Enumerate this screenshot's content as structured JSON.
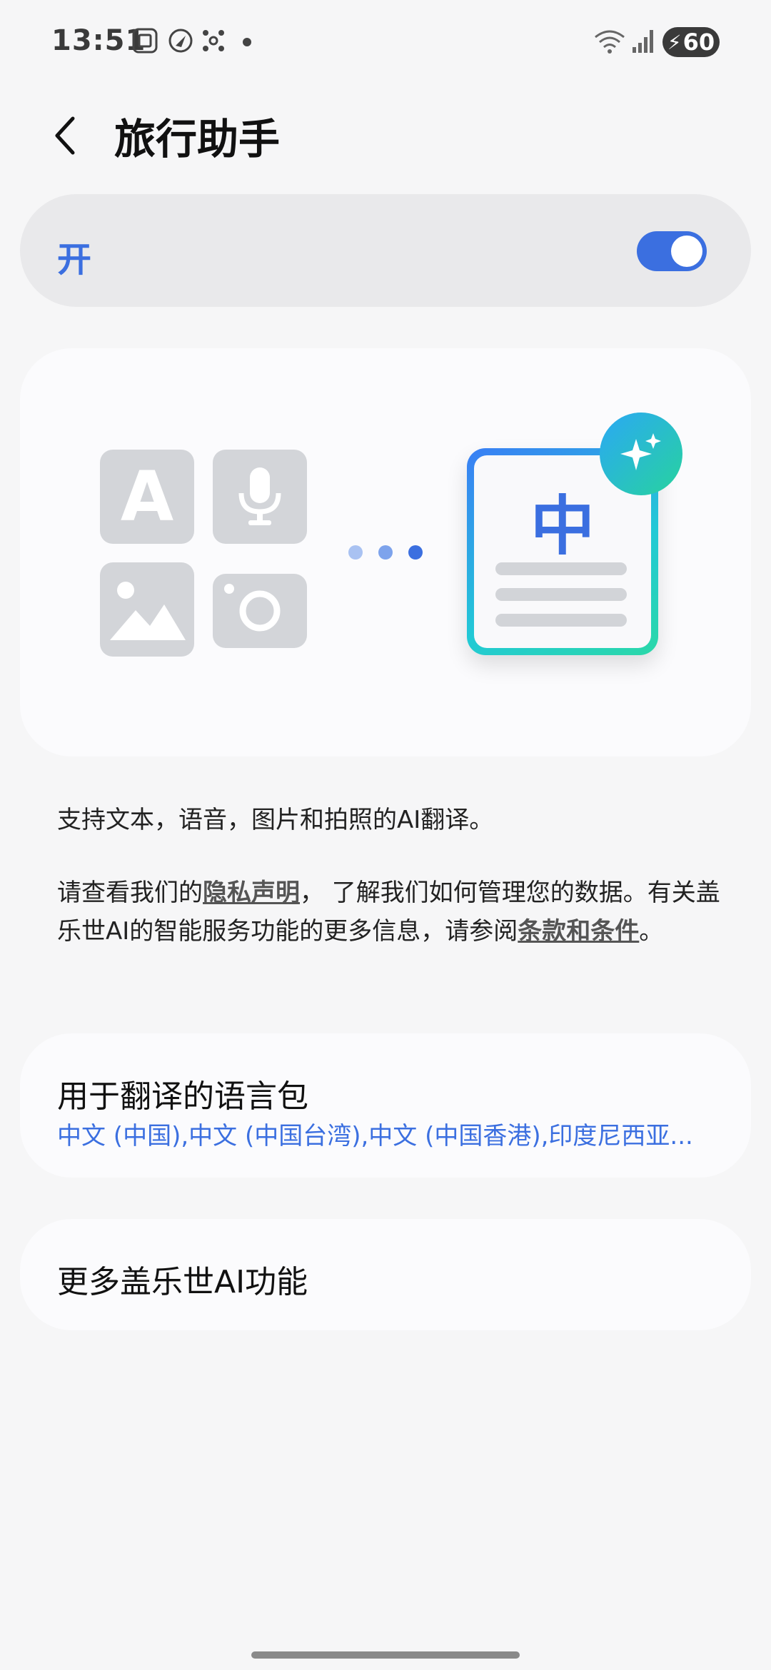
{
  "status": {
    "time": "13:51",
    "battery": "60",
    "icons": [
      "screenshot-icon",
      "location-icon",
      "connect-icon",
      "dot-icon",
      "wifi-icon",
      "signal-icon",
      "battery-charging-icon"
    ]
  },
  "header": {
    "title": "旅行助手",
    "back_icon": "chevron-left-icon"
  },
  "master_switch": {
    "label": "开",
    "state": "on"
  },
  "hero": {
    "doc_char": "中",
    "tiles": [
      "text-icon",
      "microphone-icon",
      "image-icon",
      "camera-icon"
    ],
    "badge_icon": "sparkle-icon"
  },
  "description": {
    "line1": "支持文本，语音，图片和拍照的AI翻译。",
    "privacy_prefix": "请查看我们的",
    "privacy_link": "隐私声明",
    "privacy_suffix": "， 了解我们如何管理您的数据。有关盖乐世AI的智能服务功能的更多信息，请参阅",
    "terms_link": "条款和条件",
    "terms_suffix": "。"
  },
  "language_pack": {
    "title": "用于翻译的语言包",
    "subtitle": "中文 (中国),中文 (中国台湾),中文 (中国香港),印度尼西亚..."
  },
  "more_ai": {
    "title": "更多盖乐世AI功能"
  },
  "colors": {
    "accent": "#3b6fe0",
    "background": "#f6f6f7",
    "card": "#fbfbfd"
  }
}
